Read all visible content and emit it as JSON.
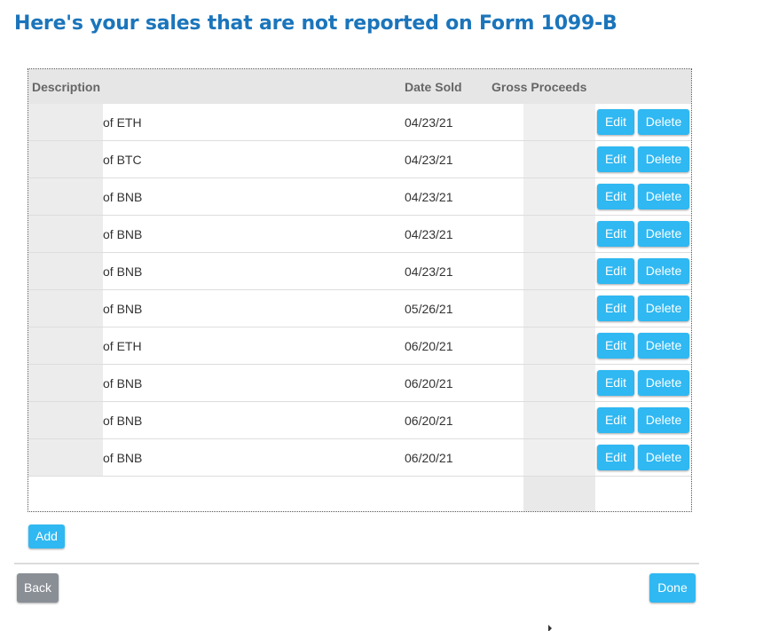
{
  "page": {
    "title": "Here's your sales that are not reported on Form 1099-B"
  },
  "table": {
    "columns": {
      "description": "Description",
      "date_sold": "Date Sold",
      "gross_proceeds": "Gross Proceeds"
    },
    "rows": [
      {
        "description": "of ETH",
        "date_sold": "04/23/21",
        "edit_label": "Edit",
        "delete_label": "Delete"
      },
      {
        "description": "of BTC",
        "date_sold": "04/23/21",
        "edit_label": "Edit",
        "delete_label": "Delete"
      },
      {
        "description": "of BNB",
        "date_sold": "04/23/21",
        "edit_label": "Edit",
        "delete_label": "Delete"
      },
      {
        "description": "of BNB",
        "date_sold": "04/23/21",
        "edit_label": "Edit",
        "delete_label": "Delete"
      },
      {
        "description": "of BNB",
        "date_sold": "04/23/21",
        "edit_label": "Edit",
        "delete_label": "Delete"
      },
      {
        "description": "of BNB",
        "date_sold": "05/26/21",
        "edit_label": "Edit",
        "delete_label": "Delete"
      },
      {
        "description": "of ETH",
        "date_sold": "06/20/21",
        "edit_label": "Edit",
        "delete_label": "Delete"
      },
      {
        "description": "of BNB",
        "date_sold": "06/20/21",
        "edit_label": "Edit",
        "delete_label": "Delete"
      },
      {
        "description": "of BNB",
        "date_sold": "06/20/21",
        "edit_label": "Edit",
        "delete_label": "Delete"
      },
      {
        "description": "of BNB",
        "date_sold": "06/20/21",
        "edit_label": "Edit",
        "delete_label": "Delete"
      }
    ]
  },
  "actions": {
    "add_label": "Add",
    "back_label": "Back",
    "done_label": "Done"
  },
  "colors": {
    "title": "#1b75bb",
    "primary_button": "#2fb8f2",
    "secondary_button": "#8a8f96",
    "header_bg": "#e6e6e6"
  },
  "icons": {
    "cursor": "mouse-pointer-icon"
  }
}
